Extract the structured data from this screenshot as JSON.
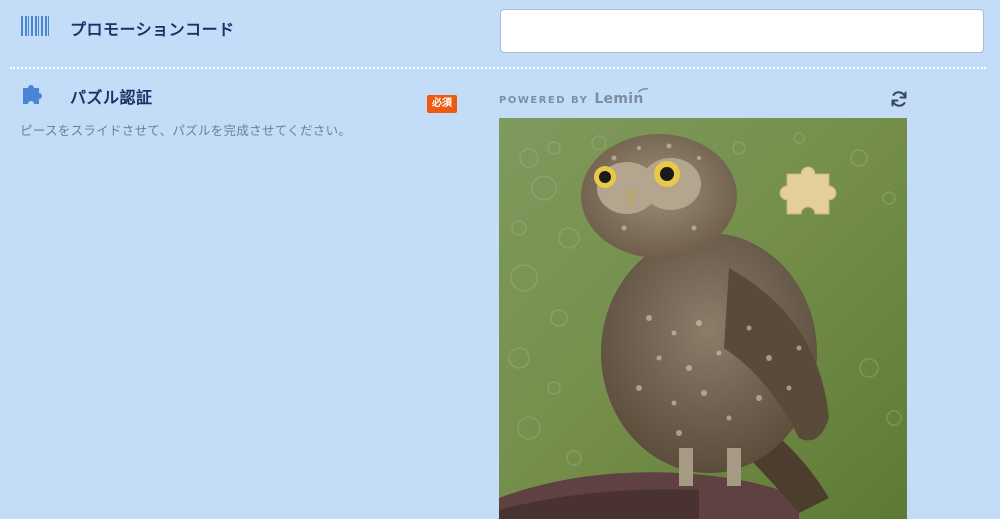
{
  "promo": {
    "label": "プロモーションコード",
    "input_value": "",
    "input_placeholder": "",
    "icon": "barcode-icon"
  },
  "puzzle": {
    "label": "パズル認証",
    "icon": "puzzle-icon",
    "required_badge": "必須",
    "help_text": "ピースをスライドさせて、パズルを完成させてください。",
    "powered_by": "POWERED BY",
    "brand": "Lemin",
    "refresh_icon": "refresh-icon",
    "image_subject": "owl-icon",
    "piece_icon": "puzzle-piece-icon"
  },
  "colors": {
    "background": "#c3ddf8",
    "label_text": "#1e2f66",
    "icon_blue": "#4a86d8",
    "badge": "#ef5a13",
    "help_text": "#6d7f95"
  }
}
